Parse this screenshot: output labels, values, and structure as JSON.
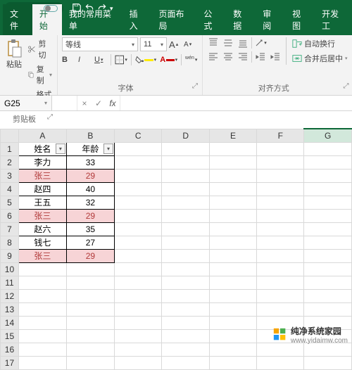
{
  "titlebar": {
    "autosave": "自动保存"
  },
  "tabs": {
    "file": "文件",
    "home": "开始",
    "custom": "我的常用菜单",
    "insert": "插入",
    "layout": "页面布局",
    "formulas": "公式",
    "data": "数据",
    "review": "审阅",
    "view": "视图",
    "dev": "开发工"
  },
  "ribbon": {
    "clipboard": {
      "paste": "粘贴",
      "cut": "剪切",
      "copy": "复制",
      "format_painter": "格式刷",
      "label": "剪贴板"
    },
    "font": {
      "name": "等线",
      "size": "11",
      "label": "字体",
      "inc": "A",
      "dec": "A",
      "bold": "B",
      "italic": "I",
      "underline": "U"
    },
    "align": {
      "wrap": "自动换行",
      "merge": "合并后居中",
      "label": "对齐方式"
    }
  },
  "chart_data": {
    "type": "table",
    "headers": [
      "姓名",
      "年龄"
    ],
    "rows": [
      {
        "name": "李力",
        "age": 33,
        "highlight": false
      },
      {
        "name": "张三",
        "age": 29,
        "highlight": true
      },
      {
        "name": "赵四",
        "age": 40,
        "highlight": false
      },
      {
        "name": "王五",
        "age": 32,
        "highlight": false
      },
      {
        "name": "张三",
        "age": 29,
        "highlight": true
      },
      {
        "name": "赵六",
        "age": 35,
        "highlight": false
      },
      {
        "name": "钱七",
        "age": 27,
        "highlight": false
      },
      {
        "name": "张三",
        "age": 29,
        "highlight": true
      }
    ]
  },
  "namebox": {
    "ref": "G25",
    "formula": ""
  },
  "columns": [
    "A",
    "B",
    "C",
    "D",
    "E",
    "F",
    "G"
  ],
  "row_count": 17,
  "watermark": {
    "brand": "纯净系统家园",
    "url": "www.yidaimw.com"
  }
}
